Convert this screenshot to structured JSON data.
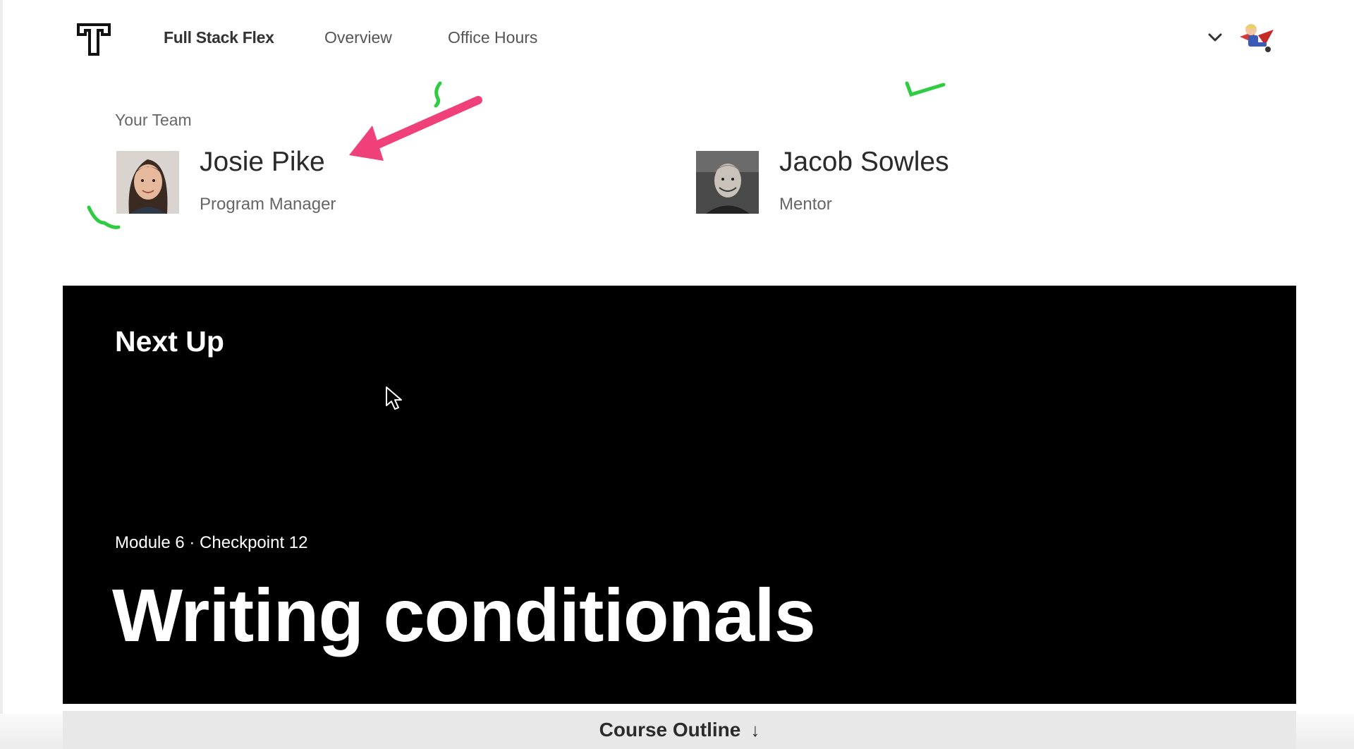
{
  "header": {
    "nav": [
      {
        "label": "Full Stack Flex"
      },
      {
        "label": "Overview"
      },
      {
        "label": "Office Hours"
      }
    ]
  },
  "team": {
    "label": "Your Team",
    "members": [
      {
        "name": "Josie Pike",
        "role": "Program Manager"
      },
      {
        "name": "Jacob Sowles",
        "role": "Mentor"
      }
    ]
  },
  "next_up": {
    "heading": "Next Up",
    "module_line": "Module 6 · Checkpoint 12",
    "title": "Writing conditionals"
  },
  "course_outline": {
    "label": "Course Outline",
    "arrow": "↓"
  },
  "colors": {
    "panel_bg": "#000000",
    "annotation_arrow": "#f0407a",
    "annotation_marks": "#2ecc40"
  },
  "icons": [
    "logo-icon",
    "chevron-down-icon",
    "user-avatar",
    "mouse-cursor-icon",
    "arrow-down-icon"
  ]
}
